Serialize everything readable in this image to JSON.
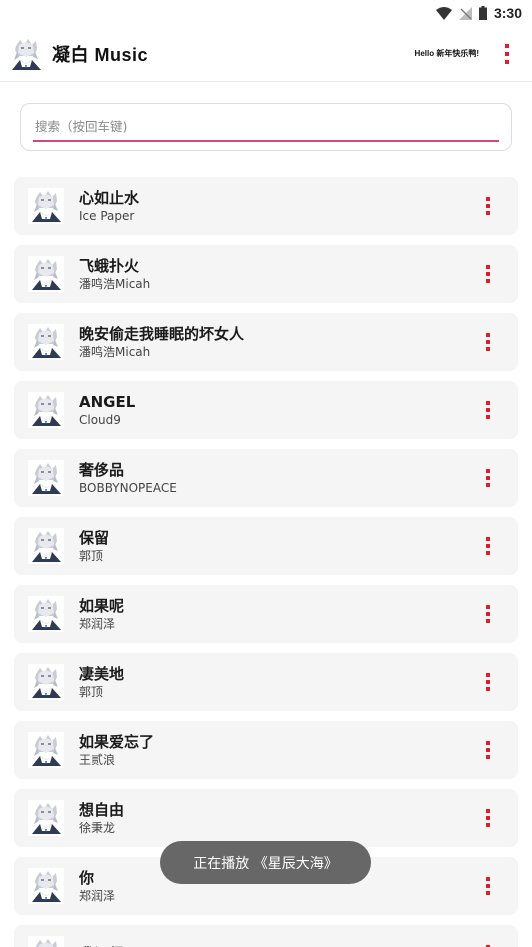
{
  "status_bar": {
    "time": "3:30",
    "icons": [
      "wifi-icon",
      "signal-no-sim-icon",
      "battery-icon"
    ]
  },
  "app_bar": {
    "title": "凝白 Music",
    "greeting": "Hello 新年快乐鸭!",
    "logo_icon": "anime-avatar-logo",
    "menu_icon": "more-vert-icon"
  },
  "search": {
    "placeholder": "搜索（按回车键)",
    "value": ""
  },
  "songs": [
    {
      "title": "心如止水",
      "artist": "Ice Paper"
    },
    {
      "title": "飞蛾扑火",
      "artist": "潘鸣浩Micah"
    },
    {
      "title": "晚安偷走我睡眠的坏女人",
      "artist": "潘鸣浩Micah"
    },
    {
      "title": "ANGEL",
      "artist": "Cloud9"
    },
    {
      "title": "奢侈品",
      "artist": "BOBBYNOPEACE"
    },
    {
      "title": "保留",
      "artist": "郭顶"
    },
    {
      "title": "如果呢",
      "artist": "郑润泽"
    },
    {
      "title": "凄美地",
      "artist": "郭顶"
    },
    {
      "title": "如果爱忘了",
      "artist": "王贰浪"
    },
    {
      "title": "想自由",
      "artist": "徐秉龙"
    },
    {
      "title": "你",
      "artist": "郑润泽"
    },
    {
      "title": "我记得",
      "artist": ""
    }
  ],
  "toast": {
    "text": "正在播放 《星辰大海》"
  },
  "colors": {
    "accent": "#e0407b",
    "menu_dots": "#e51c2c",
    "row_background": "#f5f5f5",
    "toast_background": "#5a5a5a"
  }
}
